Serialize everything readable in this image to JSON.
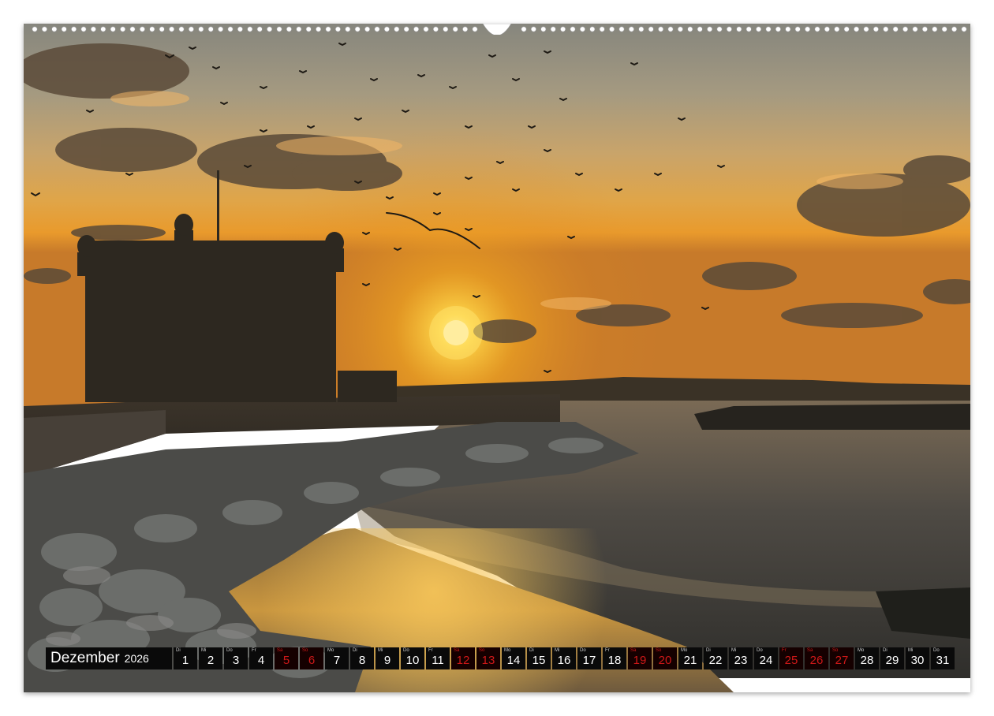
{
  "calendar": {
    "month": "Dezember",
    "year": "2026",
    "days": [
      {
        "wd": "Di",
        "num": "1",
        "holiday": false
      },
      {
        "wd": "Mi",
        "num": "2",
        "holiday": false
      },
      {
        "wd": "Do",
        "num": "3",
        "holiday": false
      },
      {
        "wd": "Fr",
        "num": "4",
        "holiday": false
      },
      {
        "wd": "Sa",
        "num": "5",
        "holiday": true
      },
      {
        "wd": "So",
        "num": "6",
        "holiday": true
      },
      {
        "wd": "Mo",
        "num": "7",
        "holiday": false
      },
      {
        "wd": "Di",
        "num": "8",
        "holiday": false
      },
      {
        "wd": "Mi",
        "num": "9",
        "holiday": false
      },
      {
        "wd": "Do",
        "num": "10",
        "holiday": false
      },
      {
        "wd": "Fr",
        "num": "11",
        "holiday": false
      },
      {
        "wd": "Sa",
        "num": "12",
        "holiday": true
      },
      {
        "wd": "So",
        "num": "13",
        "holiday": true
      },
      {
        "wd": "Mo",
        "num": "14",
        "holiday": false
      },
      {
        "wd": "Di",
        "num": "15",
        "holiday": false
      },
      {
        "wd": "Mi",
        "num": "16",
        "holiday": false
      },
      {
        "wd": "Do",
        "num": "17",
        "holiday": false
      },
      {
        "wd": "Fr",
        "num": "18",
        "holiday": false
      },
      {
        "wd": "Sa",
        "num": "19",
        "holiday": true
      },
      {
        "wd": "So",
        "num": "20",
        "holiday": true
      },
      {
        "wd": "Mo",
        "num": "21",
        "holiday": false
      },
      {
        "wd": "Di",
        "num": "22",
        "holiday": false
      },
      {
        "wd": "Mi",
        "num": "23",
        "holiday": false
      },
      {
        "wd": "Do",
        "num": "24",
        "holiday": false
      },
      {
        "wd": "Fr",
        "num": "25",
        "holiday": true
      },
      {
        "wd": "Sa",
        "num": "26",
        "holiday": true
      },
      {
        "wd": "So",
        "num": "27",
        "holiday": true
      },
      {
        "wd": "Mo",
        "num": "28",
        "holiday": false
      },
      {
        "wd": "Di",
        "num": "29",
        "holiday": false
      },
      {
        "wd": "Mi",
        "num": "30",
        "holiday": false
      },
      {
        "wd": "Do",
        "num": "31",
        "holiday": false
      }
    ]
  },
  "colors": {
    "strip_background": "#0a0a0a",
    "day_text": "#ffffff",
    "holiday_text": "#d01818",
    "sky_top": "#8a8a82",
    "sun": "#fff3a0"
  }
}
